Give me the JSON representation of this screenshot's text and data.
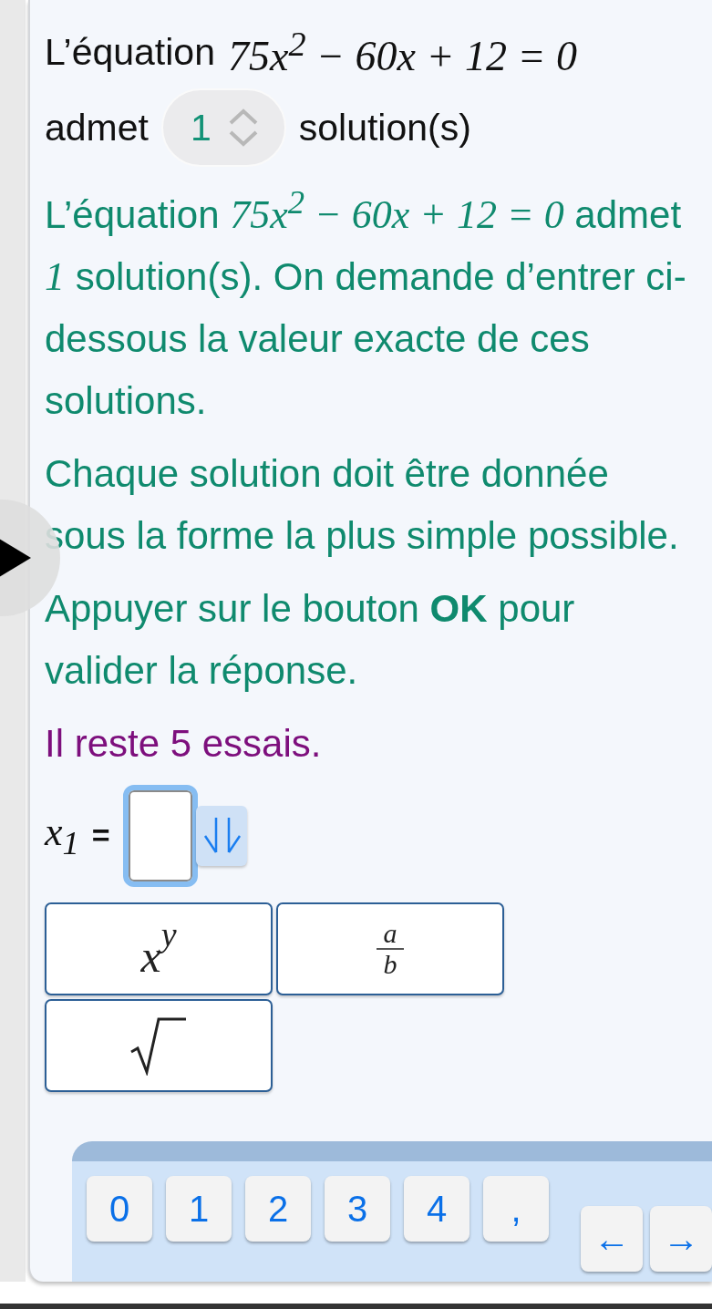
{
  "prompt": {
    "lead": "L’équation",
    "equation": "75x$^{2}$ − 60x + 12 = 0",
    "before_select": "admet",
    "select_value": "1",
    "after_select": "solution(s)"
  },
  "instructions": [
    {
      "kind": "text",
      "parts": [
        {
          "kind": "plain",
          "text": "L’équation "
        },
        {
          "kind": "math",
          "text": "75x$^{2}$ − 60x + 12 = 0"
        },
        {
          "kind": "plain",
          "text": " admet "
        },
        {
          "kind": "math",
          "text": "1"
        },
        {
          "kind": "plain",
          "text": " solution(s). On demande d’entrer ci-dessous la valeur exacte de ces solutions."
        }
      ]
    },
    {
      "kind": "text",
      "parts": [
        {
          "kind": "plain",
          "text": "Chaque solution doit être donnée sous la forme la plus simple possible."
        }
      ]
    },
    {
      "kind": "text",
      "parts": [
        {
          "kind": "plain",
          "text": "Appuyer sur le bouton **OK** pour valider la réponse."
        }
      ]
    },
    {
      "kind": "attempts",
      "parts": [
        {
          "kind": "plain",
          "text": "Il reste 5 essais."
        }
      ]
    }
  ],
  "answer": {
    "variable": "x$_{1}$",
    "equals": "="
  },
  "templates": [
    {
      "kind": "power",
      "base": "x",
      "exponent": "y"
    },
    {
      "kind": "fraction",
      "numerator": "a",
      "denominator": "b"
    },
    {
      "kind": "sqrt"
    }
  ],
  "keypad": {
    "keys": [
      "0",
      "1",
      "2",
      "3",
      "4",
      ","
    ],
    "arrows": [
      "←",
      "→"
    ]
  }
}
